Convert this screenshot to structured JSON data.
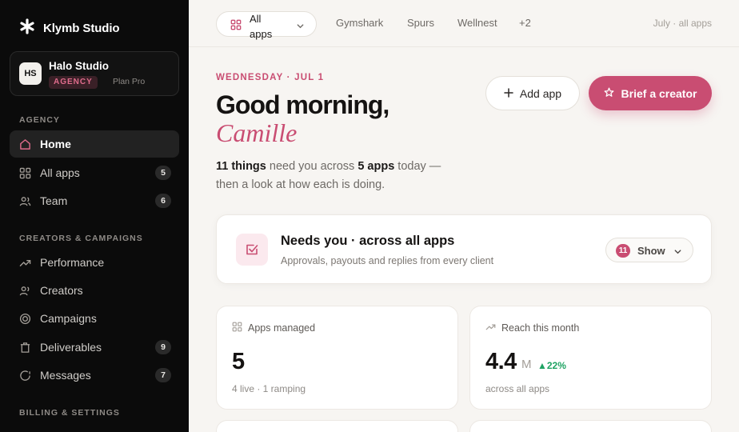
{
  "brand": {
    "name": "Klymb Studio",
    "icon": "asterisk-logo"
  },
  "workspace": {
    "initials": "HS",
    "name": "Halo Studio",
    "badge": "AGENCY",
    "plan": "Plan Pro"
  },
  "sidebar": {
    "sections": [
      {
        "title": "AGENCY"
      },
      {
        "title": "CREATORS & CAMPAIGNS"
      },
      {
        "title": "BILLING & SETTINGS"
      }
    ],
    "items": [
      {
        "label": "Home",
        "icon": "home-icon",
        "active": true
      },
      {
        "label": "All apps",
        "icon": "grid-icon",
        "count": "5"
      },
      {
        "label": "Team",
        "icon": "team-icon",
        "count": "6"
      },
      {
        "label": "Performance",
        "icon": "trend-icon"
      },
      {
        "label": "Creators",
        "icon": "users-icon"
      },
      {
        "label": "Campaigns",
        "icon": "target-icon"
      },
      {
        "label": "Deliverables",
        "icon": "clipboard-icon",
        "count": "9"
      },
      {
        "label": "Messages",
        "icon": "message-icon",
        "count": "7"
      }
    ]
  },
  "topbar": {
    "app_select": "All apps",
    "tabs": [
      "Gymshark",
      "Spurs",
      "Wellnest",
      "+2"
    ],
    "meta": "July · all apps"
  },
  "hero": {
    "date": "WEDNESDAY · JUL 1",
    "greeting": "Good morning,",
    "name": "Camille",
    "summary": {
      "things": "11 things",
      "mid": " need you across ",
      "apps": "5 apps",
      "rest": " today — then a look at how each is doing."
    }
  },
  "actions": {
    "add_app": "Add app",
    "brief": "Brief a creator"
  },
  "needs": {
    "title": "Needs you · across all apps",
    "subtitle": "Approvals, payouts and replies from every client",
    "count": "11",
    "show": "Show"
  },
  "stats": [
    {
      "label": "Apps managed",
      "icon": "grid-icon",
      "value": "5",
      "foot": "4 live · 1 ramping"
    },
    {
      "label": "Reach this month",
      "icon": "trend-icon",
      "value": "4.4",
      "unit": "M",
      "delta": "▲22%",
      "foot": "across all apps"
    }
  ],
  "colors": {
    "accent": "#c94d72",
    "sidebar": "#0b0b0b",
    "positive": "#1fa363"
  }
}
